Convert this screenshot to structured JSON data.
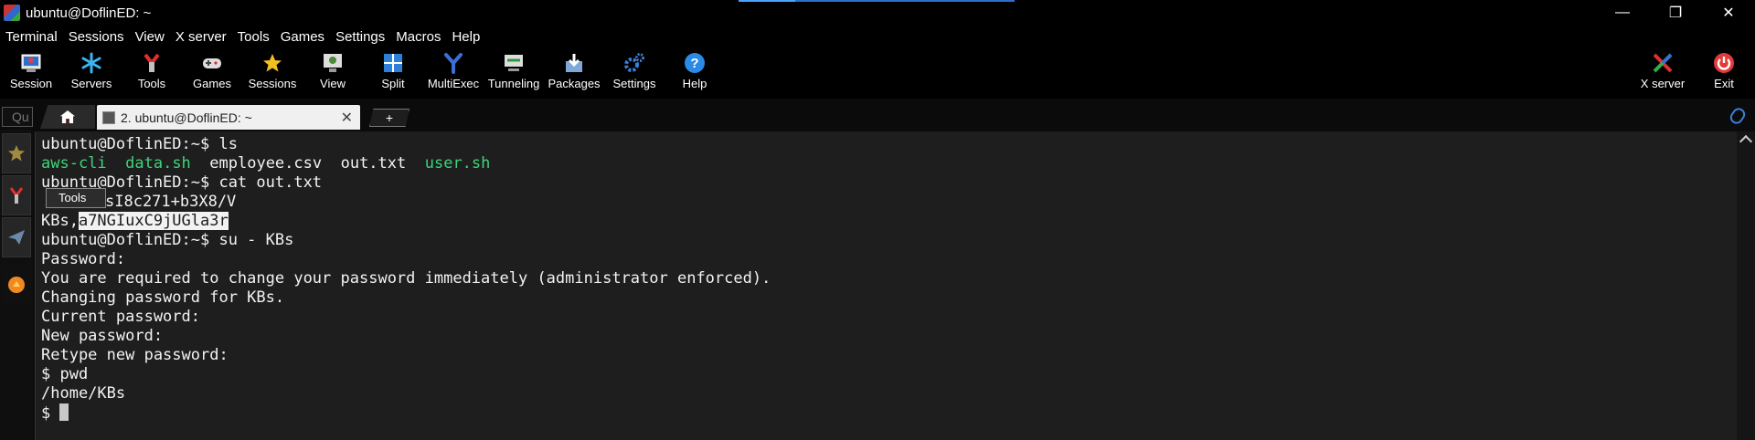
{
  "window": {
    "title": "ubuntu@DoflinED: ~",
    "minimize": "—",
    "restore": "❐",
    "close": "✕"
  },
  "menu": [
    "Terminal",
    "Sessions",
    "View",
    "X server",
    "Tools",
    "Games",
    "Settings",
    "Macros",
    "Help"
  ],
  "toolbar": {
    "session": "Session",
    "servers": "Servers",
    "tools": "Tools",
    "games": "Games",
    "sessions": "Sessions",
    "view": "View",
    "split": "Split",
    "multiexec": "MultiExec",
    "tunneling": "Tunneling",
    "packages": "Packages",
    "settings": "Settings",
    "help": "Help",
    "xserver": "X server",
    "exit": "Exit"
  },
  "tabs": {
    "quick_connect_placeholder": "Qu",
    "session_tab": "2. ubuntu@DoflinED: ~",
    "close": "✕",
    "new_tab": "+"
  },
  "tooltip": "Tools",
  "terminal": {
    "l1": "ubuntu@DoflinED:~$ ls",
    "l2_aws": "aws-cli",
    "l2_data": "data.sh",
    "l2_emp": "employee.csv",
    "l2_out": "out.txt",
    "l2_user": "user.sh",
    "l3": "ubuntu@DoflinED:~$ cat out.txt",
    "l4": "sI8c271+b3X8/V",
    "l5_prefix": "KBs,",
    "l5_sel": "a7NGIuxC9jUGla3r",
    "l6": "ubuntu@DoflinED:~$ su - KBs",
    "l7": "Password:",
    "l8": "You are required to change your password immediately (administrator enforced).",
    "l9": "Changing password for KBs.",
    "l10": "Current password:",
    "l11": "New password:",
    "l12": "Retype new password:",
    "l13": "$ pwd",
    "l14": "/home/KBs",
    "l15": "$ "
  }
}
